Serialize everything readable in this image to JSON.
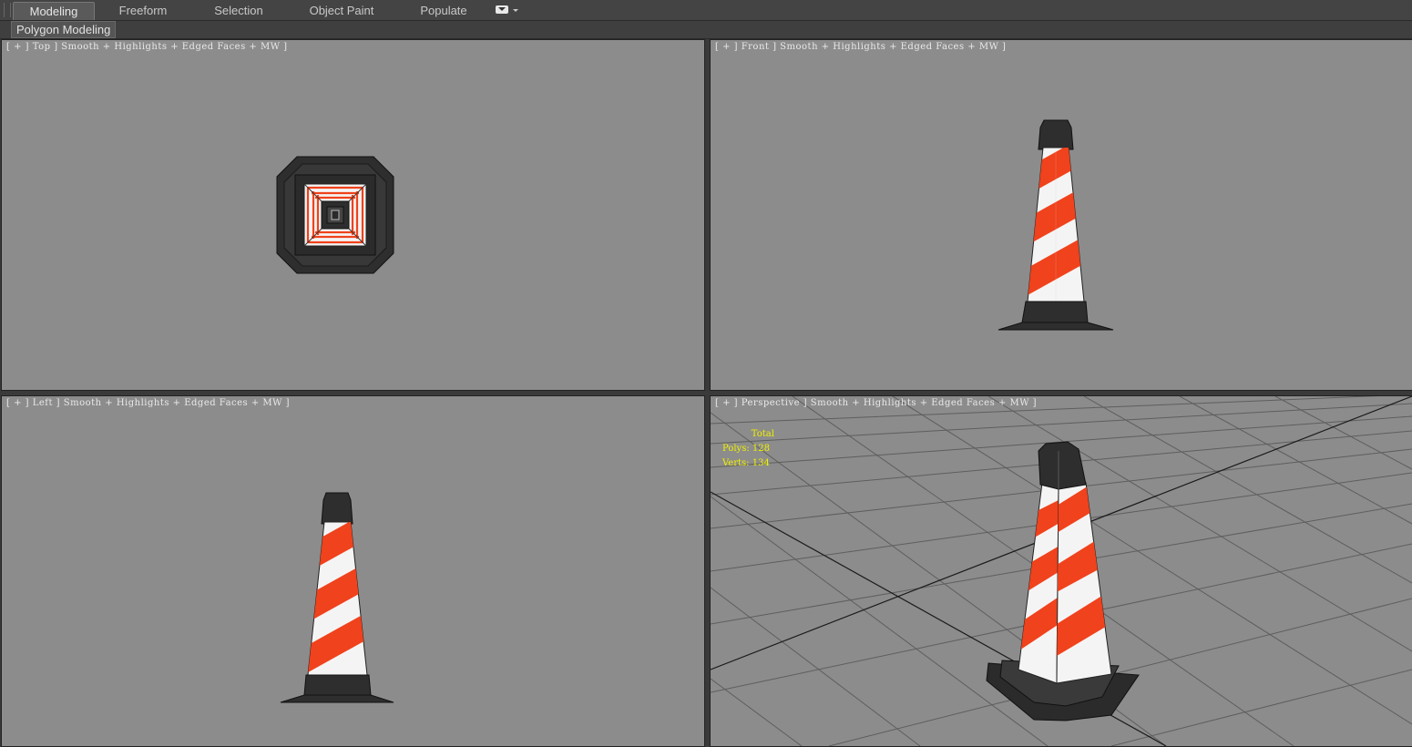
{
  "ribbon": {
    "tabs": [
      {
        "label": "Modeling",
        "active": true
      },
      {
        "label": "Freeform",
        "active": false
      },
      {
        "label": "Selection",
        "active": false
      },
      {
        "label": "Object Paint",
        "active": false
      },
      {
        "label": "Populate",
        "active": false
      }
    ],
    "panel_label": "Polygon Modeling"
  },
  "viewports": {
    "top": {
      "label": [
        "[",
        "+",
        "]",
        "Top",
        "]",
        "Smooth + Highlights + Edged Faces + MW",
        "]"
      ]
    },
    "front": {
      "label": [
        "[",
        "+",
        "]",
        "Front",
        "]",
        "Smooth + Highlights + Edged Faces + MW",
        "]"
      ]
    },
    "left": {
      "label": [
        "[",
        "+",
        "]",
        "Left",
        "]",
        "Smooth + Highlights + Edged Faces + MW",
        "]"
      ]
    },
    "persp": {
      "label": [
        "[",
        "+",
        "]",
        "Perspective",
        "]",
        "Smooth + Highlights + Edged Faces + MW",
        "]"
      ]
    }
  },
  "labels": {
    "top": "[ + ] Top ] Smooth + Highlights + Edged Faces + MW ]",
    "front": "[ + ] Front ] Smooth + Highlights + Edged Faces + MW ]",
    "left": "[ + ] Left ] Smooth + Highlights + Edged Faces + MW ]",
    "persp": "[ + ] Perspective ] Smooth + Highlights + Edged Faces + MW ]"
  },
  "stats": {
    "header": "Total",
    "polys_label": "Polys:",
    "polys_value": "128",
    "verts_label": "Verts:",
    "verts_value": "134"
  },
  "colors": {
    "viewport_bg": "#8c8c8c",
    "stripe_red": "#f0421c",
    "stripe_white": "#f4f4f4",
    "cone_black": "#2e2e2e",
    "stats_text": "#f0f000",
    "grid_line": "#5e5e5e"
  }
}
